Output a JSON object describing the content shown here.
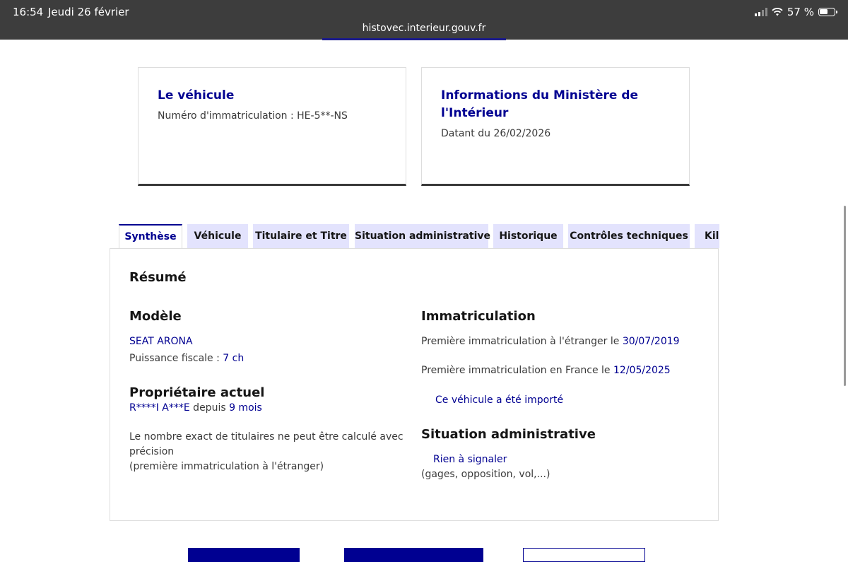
{
  "status_bar": {
    "time": "16:54",
    "date": "Jeudi 26 février",
    "battery": "57 %",
    "url": "histovec.interieur.gouv.fr"
  },
  "cards": [
    {
      "title": "Le véhicule",
      "text": "Numéro d'immatriculation : HE-5**-NS"
    },
    {
      "title": "Informations du Ministère de l'Intérieur",
      "text": "Datant du 26/02/2026"
    }
  ],
  "tabs": [
    {
      "label": "Synthèse",
      "active": true
    },
    {
      "label": "Véhicule"
    },
    {
      "label": "Titulaire et Titre"
    },
    {
      "label": "Situation administrative"
    },
    {
      "label": "Historique"
    },
    {
      "label": "Contrôles techniques"
    },
    {
      "label": "Kilométrage"
    }
  ],
  "summary": {
    "title": "Résumé",
    "model": {
      "heading": "Modèle",
      "name": "SEAT ARONA",
      "power_label": "Puissance fiscale : ",
      "power_value": "7 ch"
    },
    "owner": {
      "heading": "Propriétaire actuel",
      "name": "R****I A***E",
      "since_label": " depuis ",
      "since_value": "9 mois",
      "note_line1": "Le nombre exact de titulaires ne peut être calculé avec",
      "note_line2": "précision",
      "note_line3": "(première immatriculation à l'étranger)"
    },
    "registration": {
      "heading": "Immatriculation",
      "foreign_label": "Première immatriculation à l'étranger le ",
      "foreign_date": "30/07/2019",
      "france_label": "Première immatriculation en France le ",
      "france_date": "12/05/2025",
      "imported": "Ce véhicule a été importé"
    },
    "admin": {
      "heading": "Situation administrative",
      "status": "Rien à signaler",
      "detail": "(gages, opposition, vol,...)"
    }
  },
  "colors": {
    "accent": "#000091",
    "tab_bg": "#e3e3fd",
    "status_bar": "#3d3d3d"
  }
}
